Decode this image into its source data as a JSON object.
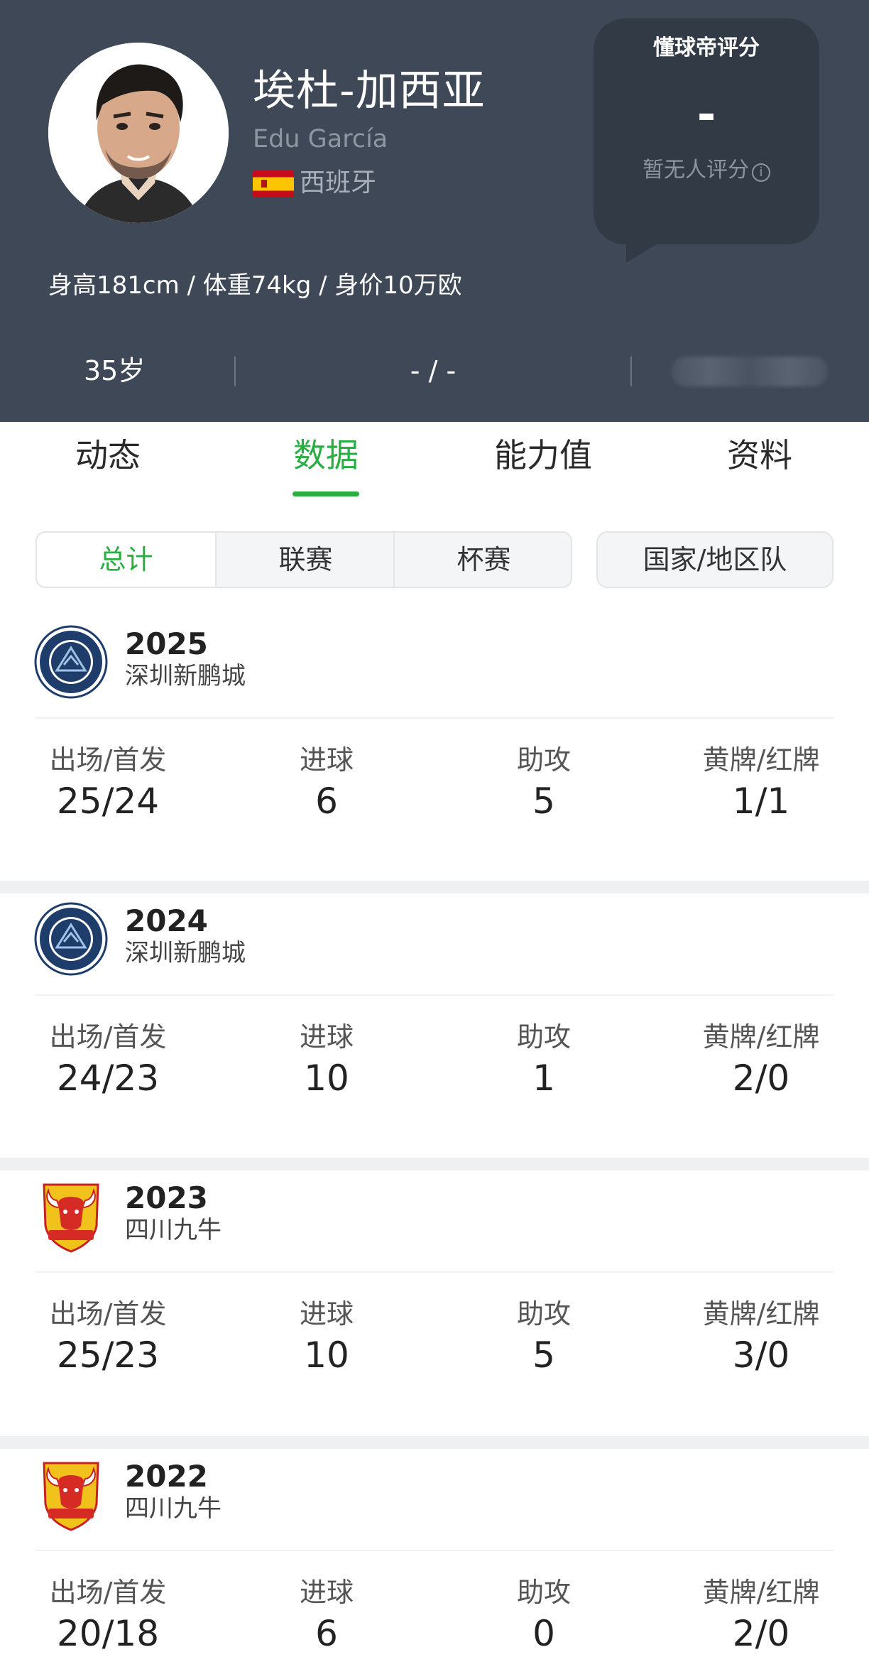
{
  "player": {
    "name_cn": "埃杜-加西亚",
    "name_en": "Edu García",
    "nationality": "西班牙",
    "flag_colors": [
      "#c60b1e",
      "#ffc400"
    ],
    "physical": "身高181cm / 体重74kg / 身价10万欧",
    "age": "35岁",
    "mid_stat": "- / -"
  },
  "rating": {
    "title": "懂球帝评分",
    "value": "-",
    "note": "暂无人评分",
    "info_icon": "i"
  },
  "tabs": [
    {
      "label": "动态"
    },
    {
      "label": "数据"
    },
    {
      "label": "能力值"
    },
    {
      "label": "资料"
    }
  ],
  "active_tab": "数据",
  "filters": {
    "segments": [
      "总计",
      "联赛",
      "杯赛"
    ],
    "active": "总计",
    "national": "国家/地区队"
  },
  "stat_labels": [
    "出场/首发",
    "进球",
    "助攻",
    "黄牌/红牌"
  ],
  "seasons": [
    {
      "year": "2025",
      "club": "深圳新鹏城",
      "logo": "shenzhen-peng-city-logo",
      "apps": "25/24",
      "goals": "6",
      "assists": "5",
      "cards": "1/1"
    },
    {
      "year": "2024",
      "club": "深圳新鹏城",
      "logo": "shenzhen-peng-city-logo",
      "apps": "24/23",
      "goals": "10",
      "assists": "1",
      "cards": "2/0"
    },
    {
      "year": "2023",
      "club": "四川九牛",
      "logo": "sichuan-jiuniu-logo",
      "apps": "25/23",
      "goals": "10",
      "assists": "5",
      "cards": "3/0"
    },
    {
      "year": "2022",
      "club": "四川九牛",
      "logo": "sichuan-jiuniu-logo",
      "apps": "20/18",
      "goals": "6",
      "assists": "0",
      "cards": "2/0"
    }
  ],
  "colors": {
    "header_bg": "#3f4856",
    "accent_green": "#2aae43",
    "rating_card_bg": "#323a46"
  }
}
